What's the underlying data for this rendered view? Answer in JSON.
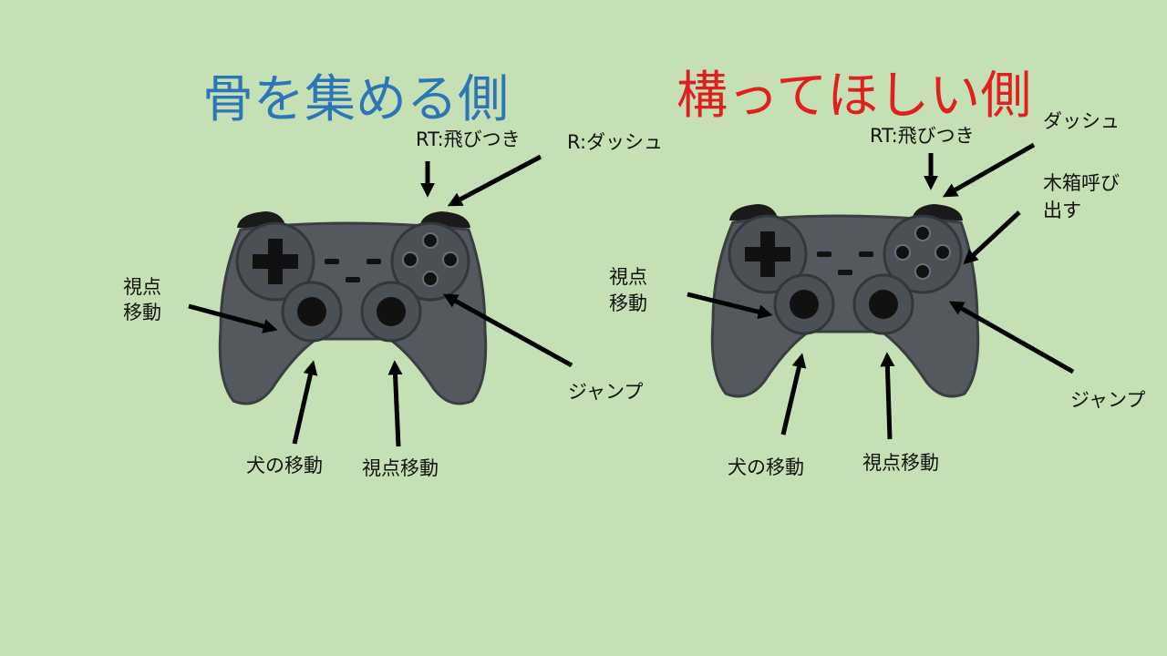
{
  "colors": {
    "background": "#c5e0b4",
    "left_title": "#2e75b6",
    "right_title": "#e02020",
    "controller_body": "#54585f",
    "controller_outline": "#3a3d42",
    "button_black": "#111111"
  },
  "left": {
    "title": "骨を集める側",
    "labels": {
      "rt": "RT:飛びつき",
      "r": "R:ダッシュ",
      "view_left_line1": "視点",
      "view_left_line2": "移動",
      "jump": "ジャンプ",
      "dog_move": "犬の移動",
      "view_move": "視点移動"
    }
  },
  "right": {
    "title": "構ってほしい側",
    "labels": {
      "dash": "ダッシュ",
      "rt": "RT:飛びつき",
      "crate_line1": "木箱呼び",
      "crate_line2": "出す",
      "view_left_line1": "視点",
      "view_left_line2": "移動",
      "jump": "ジャンプ",
      "dog_move": "犬の移動",
      "view_move": "視点移動"
    }
  }
}
